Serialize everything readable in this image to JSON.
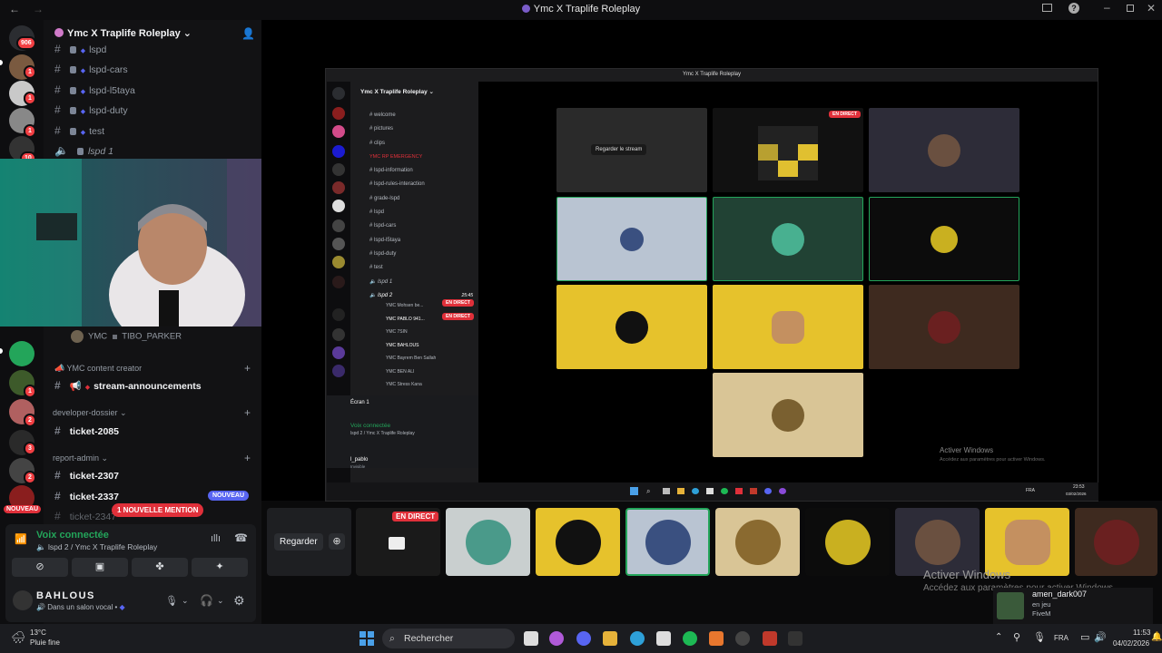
{
  "window": {
    "title": "Ymc X Traplife Roleplay"
  },
  "server": {
    "name": "Ymc X Traplife Roleplay"
  },
  "guild_badges": [
    "906",
    "1",
    "1",
    "1",
    "10",
    "1",
    "2",
    "3",
    "2"
  ],
  "channels_top": [
    {
      "name": "lspd"
    },
    {
      "name": "lspd-cars"
    },
    {
      "name": "lspd-l5taya"
    },
    {
      "name": "lspd-duty"
    },
    {
      "name": "test"
    },
    {
      "name": "lspd 1",
      "voice": true
    }
  ],
  "voice_member": {
    "tag": "YMC",
    "name": "TIBO_PARKER"
  },
  "categories": [
    {
      "name": "YMC content creator",
      "channels": [
        "stream-announcements"
      ]
    },
    {
      "name": "developer-dossier",
      "channels": [
        "ticket-2085"
      ]
    },
    {
      "name": "report-admin",
      "channels": [
        "ticket-2307",
        "ticket-2337",
        "ticket-2347"
      ]
    }
  ],
  "badges": {
    "nouveau": "NOUVEAU",
    "mention": "1 NOUVELLE MENTION",
    "live": "EN DIRECT"
  },
  "voice_panel": {
    "status": "Voix connectée",
    "channel": "lspd 2 / Ymc X Traplife Roleplay"
  },
  "user": {
    "name": "BAHLOUS",
    "status": "Dans un salon vocal"
  },
  "strip": {
    "watch_label": "Regarder"
  },
  "inner": {
    "title": "Ymc X Traplife Roleplay",
    "server": "Ymc X Traplife Roleplay",
    "channels": [
      "welcome",
      "pictures",
      "clips",
      "YMC RP EMERGENCY",
      "lspd-information",
      "lspd-rules-interaction",
      "grade-lspd",
      "lspd",
      "lspd-cars",
      "lspd-l5taya",
      "lspd-duty",
      "test",
      "lspd 1",
      "lspd 2"
    ],
    "voice_time": "25:45",
    "members": [
      {
        "tag": "YMC",
        "name": "Mohsen be..."
      },
      {
        "tag": "YMC",
        "name": "PABLO 941..."
      },
      {
        "tag": "YMC",
        "name": "7SIN"
      },
      {
        "tag": "YMC",
        "name": "BAHLOUS"
      },
      {
        "tag": "YMC",
        "name": "Bayrem Ben Sallah"
      },
      {
        "tag": "YMC",
        "name": "BEN ALI"
      },
      {
        "tag": "YMC",
        "name": "Stress Kana"
      }
    ],
    "screen_label": "Écran 1",
    "voice_status": "Voix connectée",
    "voice_channel": "lspd 2 / Ymc X Traplife Roleplay",
    "user_name": "l_pablo",
    "user_sub": "Invisible",
    "watch_stream": "Regarder le stream",
    "activate1": "Activer Windows",
    "activate2": "Accédez aux paramètres pour activer Windows.",
    "lang": "FRA",
    "time": "23:53",
    "date": "03/02/2026"
  },
  "activate": {
    "title": "Activer Windows",
    "sub": "Accédez aux paramètres pour activer Windows."
  },
  "game": {
    "user": "amen_dark007",
    "status": "en jeu",
    "game": "FiveM"
  },
  "taskbar": {
    "weather_temp": "13°C",
    "weather_desc": "Pluie fine",
    "search": "Rechercher",
    "lang": "FRA",
    "time": "11:53",
    "date": "04/02/2026"
  },
  "colors": {
    "accent": "#5865f2",
    "live": "#e0303a",
    "online": "#23a55a"
  }
}
